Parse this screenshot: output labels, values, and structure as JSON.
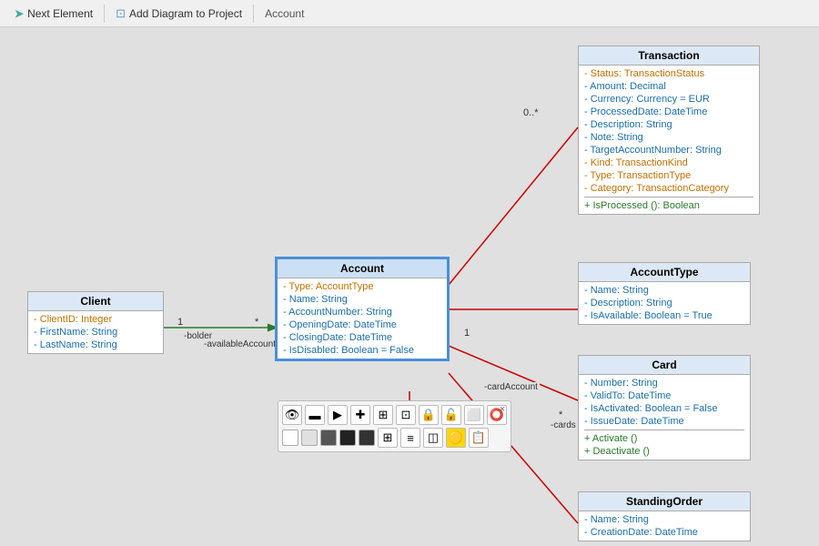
{
  "toolbar": {
    "next_element_label": "Next Element",
    "add_diagram_label": "Add Diagram to Project",
    "breadcrumb": "Account"
  },
  "canvas": {
    "client_box": {
      "title": "Client",
      "fields": [
        "- ClientID: Integer",
        "- FirstName: String",
        "- LastName: String"
      ]
    },
    "account_box": {
      "title": "Account",
      "fields": [
        "- Type: AccountType",
        "- Name: String",
        "- AccountNumber: String",
        "- OpeningDate: DateTime",
        "- ClosingDate: DateTime",
        "- IsDisabled: Boolean = False"
      ]
    },
    "transaction_box": {
      "title": "Transaction",
      "fields": [
        "- Status: TransactionStatus",
        "- Amount: Decimal",
        "- Currency: Currency = EUR",
        "- ProcessedDate: DateTime",
        "- Description: String",
        "- Note: String",
        "- TargetAccountNumber: String",
        "- Kind: TransactionKind",
        "- Type: TransactionType",
        "- Category: TransactionCategory"
      ],
      "methods": [
        "+ IsProcessed (): Boolean"
      ]
    },
    "accounttype_box": {
      "title": "AccountType",
      "fields": [
        "- Name: String",
        "- Description: String",
        "- IsAvailable: Boolean = True"
      ]
    },
    "card_box": {
      "title": "Card",
      "fields": [
        "- Number: String",
        "- ValidTo: DateTime",
        "- IsActivated: Boolean = False",
        "- IssueDate: DateTime"
      ],
      "methods": [
        "+ Activate ()",
        "+ Deactivate ()"
      ]
    },
    "standingorder_box": {
      "title": "StandingOrder",
      "fields": [
        "- Name: String",
        "- CreationDate: DateTime"
      ]
    }
  },
  "palette": {
    "close_label": "×",
    "icons": [
      "👁",
      "▬",
      "▶",
      "✚",
      "⊞",
      "⊡",
      "🔒",
      "🔓",
      "⬜",
      "⭕"
    ],
    "colors": [
      "white",
      "#e0e0e0",
      "#555",
      "#222",
      "#4a4a4a"
    ],
    "extra_icons": [
      "⊞",
      "≡",
      "◫",
      "🟡",
      "📋"
    ]
  },
  "multiplicity": {
    "client_to_account_left": "1",
    "client_to_account_right": "*",
    "account_to_transaction": "0..*",
    "account_to_card": "1",
    "card_mult": "*",
    "account_role": "-availableAccounts",
    "card_role": "-cards",
    "account_bolder": "-bolder",
    "account_to_account": "-cardAccount"
  }
}
